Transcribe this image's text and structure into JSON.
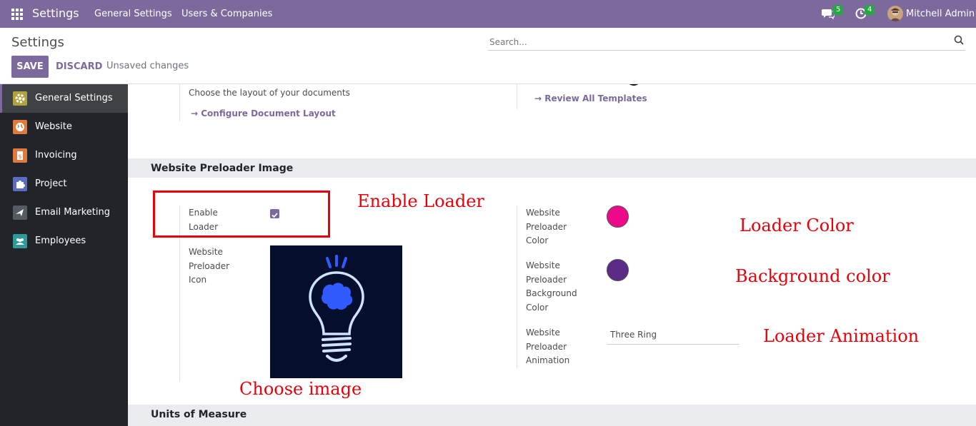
{
  "navbar": {
    "app_title": "Settings",
    "menu": [
      "General Settings",
      "Users & Companies"
    ],
    "messages_count": "5",
    "activities_count": "4",
    "user_name": "Mitchell Admin"
  },
  "control_panel": {
    "title": "Settings",
    "search_placeholder": "Search...",
    "save_label": "SAVE",
    "discard_label": "DISCARD",
    "status": "Unsaved changes"
  },
  "sidebar": {
    "items": [
      {
        "label": "General Settings",
        "icon": "gear-icon",
        "color": "#b0a23f"
      },
      {
        "label": "Website",
        "icon": "globe-icon",
        "color": "#e07a3f"
      },
      {
        "label": "Invoicing",
        "icon": "invoice-icon",
        "color": "#e07a3f"
      },
      {
        "label": "Project",
        "icon": "puzzle-icon",
        "color": "#5b6dbf"
      },
      {
        "label": "Email Marketing",
        "icon": "mail-icon",
        "color": "#555b60"
      },
      {
        "label": "Employees",
        "icon": "people-icon",
        "color": "#2f9a97"
      }
    ]
  },
  "documents": {
    "layout_desc": "Choose the layout of your documents",
    "configure_link": "Configure Document Layout",
    "review_link": "Review All Templates"
  },
  "preloader": {
    "section_title": "Website Preloader Image",
    "enable_loader_label": "Enable Loader",
    "enable_loader_checked": true,
    "icon_label": "Website Preloader Icon",
    "color_label": "Website Preloader Color",
    "color_value": "#ec0a8b",
    "bg_color_label": "Website Preloader Background Color",
    "bg_color_value": "#5b2a86",
    "animation_label": "Website Preloader Animation",
    "animation_value": "Three Ring"
  },
  "units_section_title": "Units of Measure",
  "annotations": {
    "enable_loader": "Enable Loader",
    "loader_color": "Loader Color",
    "background_color": "Background color",
    "loader_animation": "Loader Animation",
    "choose_image": "Choose image"
  },
  "colors": {
    "brand": "#7c6a9c",
    "annotation_red": "#e8000a"
  }
}
